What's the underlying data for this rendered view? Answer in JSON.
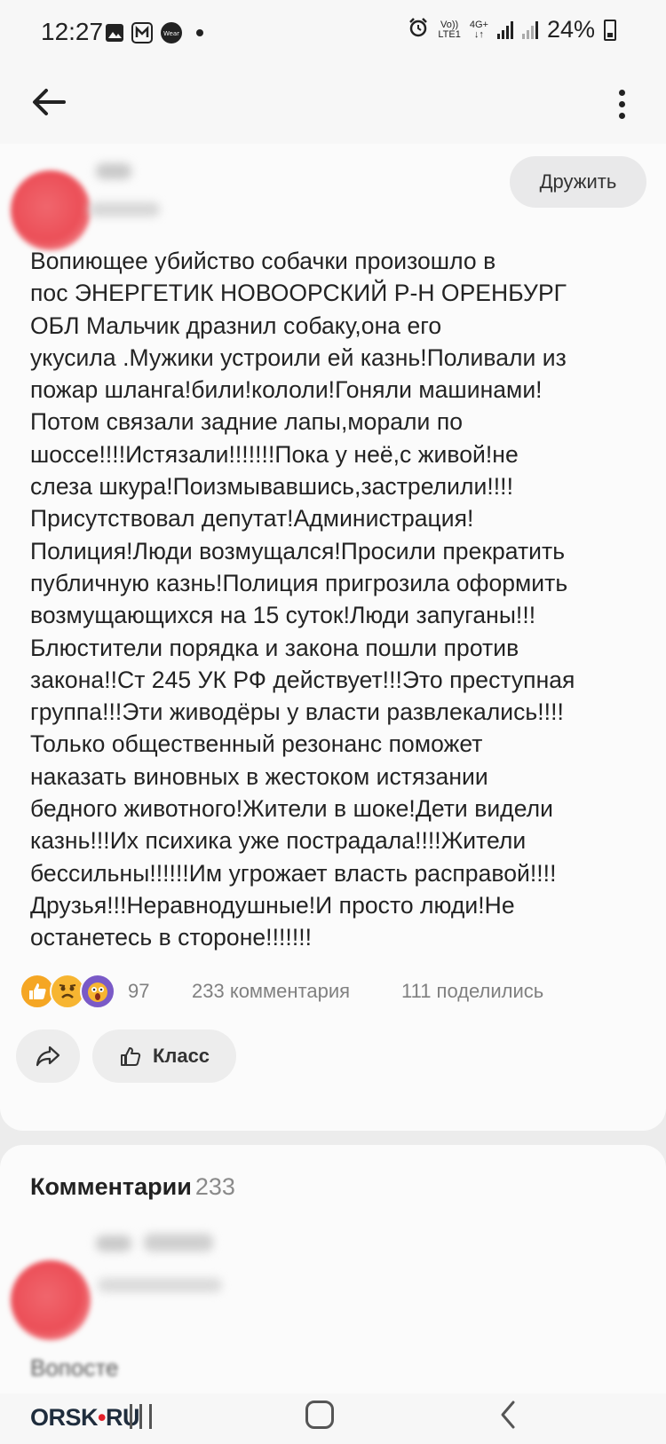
{
  "status_bar": {
    "time": "12:27",
    "network_top": "Vo))",
    "network_bottom": "LTE1",
    "data_top": "4G+",
    "battery": "24%"
  },
  "app_bar": {
    "back_icon": "arrow-left-icon",
    "more_icon": "more-vertical-icon"
  },
  "post": {
    "friend_button": "Дружить",
    "text": "Вопиющее убийство собачки произошло в\nпос ЭНЕРГЕТИК НОВООРСКИЙ Р-Н ОРЕНБУРГ\nОБЛ Мальчик дразнил собаку,она его\nукусила .Мужики устроили ей казнь!Поливали из\nпожар шланга!били!кололи!Гоняли машинами!\nПотом связали задние лапы,морали по\nшоссе!!!!Истязали!!!!!!!Пока у неё,с живой!не\nслеза шкура!Поизмывавшись,застрелили!!!!\nПрисутствовал депутат!Администрация!\nПолиция!Люди возмущался!Просили прекратить\nпубличную казнь!Полиция пригрозила оформить\nвозмущающихся на 15 суток!Люди запуганы!!!\nБлюстители порядка и закона пошли против\nзакона!!Ст 245 УК РФ действует!!!Это преступная\nгруппа!!!Эти живодёры у власти развлекались!!!!\nТолько общественный резонанс поможет\nнаказать виновных в жестоком истязании\nбедного животного!Жители в шоке!Дети видели\nказнь!!!Их психика уже пострадала!!!!Жители\nбессильны!!!!!!Им угрожает власть расправой!!!!\nДрузья!!!Неравнодушные!И просто люди!Не\nостанетесь в стороне!!!!!!!",
    "reactions_count": "97",
    "comments_count": "233 комментария",
    "shares_count": "111 поделились",
    "klass_button": "Класс"
  },
  "comments": {
    "title": "Комментарии",
    "count": "233",
    "first_text_fragment": "Вопосте"
  },
  "nav_bar": {
    "logo_main": "ORSK",
    "logo_accent": "RU"
  },
  "colors": {
    "background": "#ececec",
    "card": "#fbfbfb",
    "button": "#ededed",
    "logo_accent": "#e3202a"
  }
}
